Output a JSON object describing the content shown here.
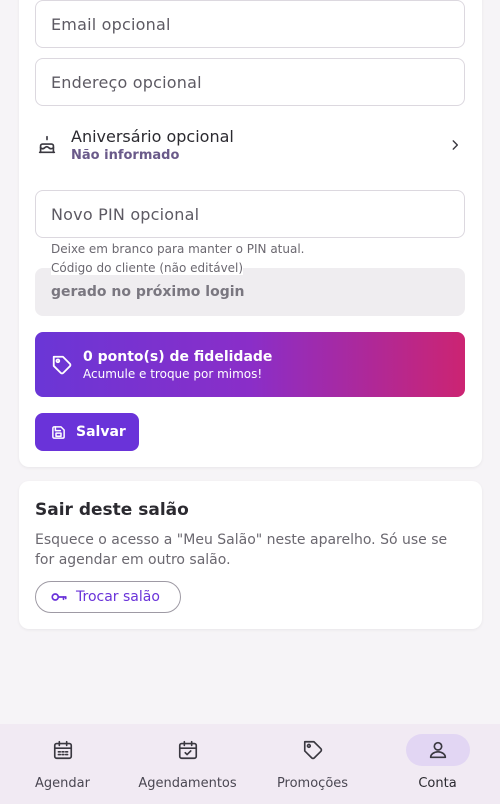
{
  "colors": {
    "accent": "#6a33d9",
    "loyalty_gradient_start": "#6a36d6",
    "loyalty_gradient_end": "#cc2472",
    "nav_background": "#f1eaf3"
  },
  "form": {
    "email_placeholder": "Email opcional",
    "address_placeholder": "Endereço opcional",
    "birthday": {
      "icon": "cake-icon",
      "label": "Aniversário opcional",
      "value": "Não informado"
    },
    "pin_placeholder": "Novo PIN opcional",
    "pin_hint": "Deixe em branco para manter o PIN atual.",
    "client_code": {
      "label": "Código do cliente (não editável)",
      "value": "gerado no próximo login"
    },
    "loyalty": {
      "icon": "tag-icon",
      "title": "0 ponto(s) de fidelidade",
      "subtitle": "Acumule e troque por mimos!"
    },
    "save_label": "Salvar"
  },
  "leave": {
    "title": "Sair deste salão",
    "description": "Esquece o acesso a \"Meu Salão\" neste aparelho. Só use se for agendar em outro salão.",
    "switch_label": "Trocar salão"
  },
  "bottom_nav": {
    "items": [
      {
        "label": "Agendar",
        "icon": "calendar-icon",
        "active": false
      },
      {
        "label": "Agendamentos",
        "icon": "calendar-check-icon",
        "active": false
      },
      {
        "label": "Promoções",
        "icon": "tag-icon",
        "active": false
      },
      {
        "label": "Conta",
        "icon": "person-icon",
        "active": true
      }
    ]
  }
}
